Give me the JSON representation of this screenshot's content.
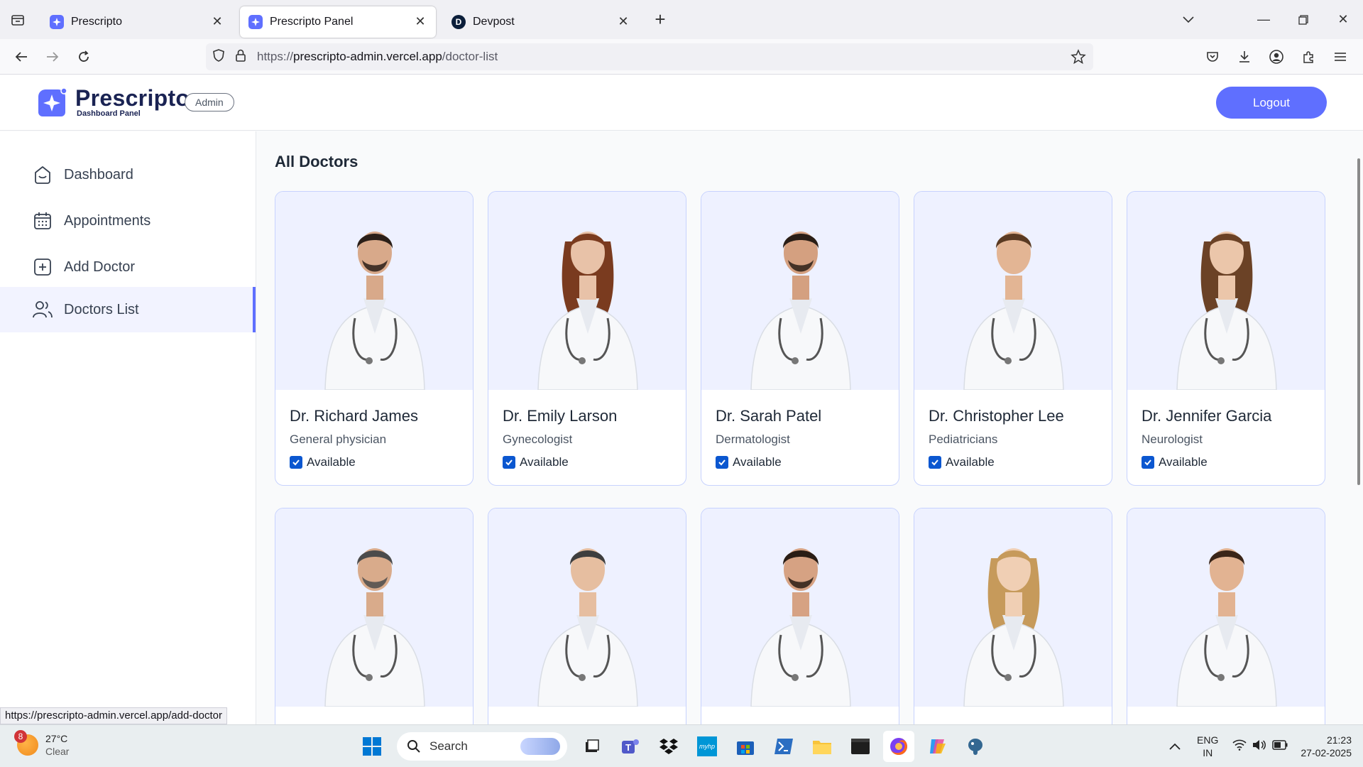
{
  "browser": {
    "tabs": [
      {
        "title": "Prescripto",
        "active": false
      },
      {
        "title": "Prescripto Panel",
        "active": true
      },
      {
        "title": "Devpost",
        "active": false
      }
    ],
    "url_prefix": "https://",
    "url_host": "prescripto-admin.vercel.app",
    "url_path": "/doctor-list",
    "status_url": "https://prescripto-admin.vercel.app/add-doctor"
  },
  "header": {
    "brand": "Prescripto",
    "brand_sub": "Dashboard Panel",
    "role": "Admin",
    "logout_label": "Logout",
    "accent": "#5f6fff"
  },
  "sidebar": {
    "items": [
      {
        "label": "Dashboard",
        "icon": "home-icon"
      },
      {
        "label": "Appointments",
        "icon": "calendar-icon"
      },
      {
        "label": "Add Doctor",
        "icon": "add-icon"
      },
      {
        "label": "Doctors List",
        "icon": "people-icon",
        "active": true
      }
    ]
  },
  "main": {
    "title": "All Doctors",
    "doctors": [
      {
        "name": "Dr. Richard James",
        "speciality": "General physician",
        "available_label": "Available",
        "available": true
      },
      {
        "name": "Dr. Emily Larson",
        "speciality": "Gynecologist",
        "available_label": "Available",
        "available": true
      },
      {
        "name": "Dr. Sarah Patel",
        "speciality": "Dermatologist",
        "available_label": "Available",
        "available": true
      },
      {
        "name": "Dr. Christopher Lee",
        "speciality": "Pediatricians",
        "available_label": "Available",
        "available": true
      },
      {
        "name": "Dr. Jennifer Garcia",
        "speciality": "Neurologist",
        "available_label": "Available",
        "available": true
      },
      {
        "name": "",
        "speciality": "",
        "available_label": "",
        "available": true
      },
      {
        "name": "",
        "speciality": "",
        "available_label": "",
        "available": true
      },
      {
        "name": "",
        "speciality": "",
        "available_label": "",
        "available": true
      },
      {
        "name": "",
        "speciality": "",
        "available_label": "",
        "available": true
      },
      {
        "name": "",
        "speciality": "",
        "available_label": "",
        "available": true
      }
    ]
  },
  "taskbar": {
    "weather_temp": "27°C",
    "weather_desc": "Clear",
    "weather_badge": "8",
    "search_label": "Search",
    "lang_1": "ENG",
    "lang_2": "IN",
    "time": "21:23",
    "date": "27-02-2025"
  }
}
